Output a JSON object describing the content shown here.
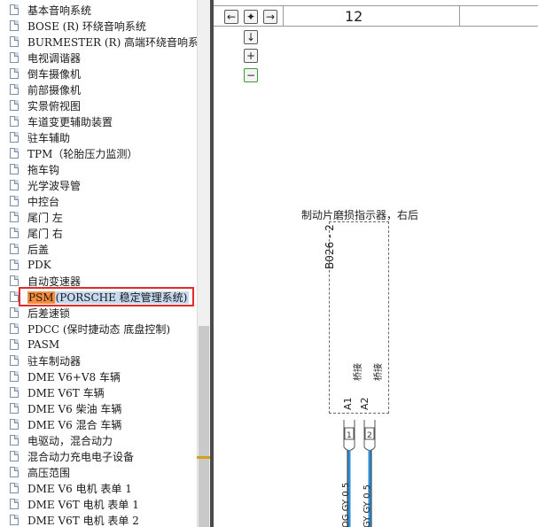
{
  "tree": {
    "items": [
      {
        "label": "基本音响系统"
      },
      {
        "label": "BOSE (R) 环绕音响系统"
      },
      {
        "label": "BURMESTER (R) 高端环绕音响系"
      },
      {
        "label": "电视调谐器"
      },
      {
        "label": "倒车摄像机"
      },
      {
        "label": "前部摄像机"
      },
      {
        "label": "实景俯视图"
      },
      {
        "label": "车道变更辅助装置"
      },
      {
        "label": "驻车辅助"
      },
      {
        "label": "TPM（轮胎压力监测）"
      },
      {
        "label": "拖车钩"
      },
      {
        "label": "光学波导管"
      },
      {
        "label": "中控台"
      },
      {
        "label": "尾门 左"
      },
      {
        "label": "尾门 右"
      },
      {
        "label": "后盖"
      },
      {
        "label": "PDK"
      },
      {
        "label": "自动变速器"
      },
      {
        "label": "PSM (PORSCHE 稳定管理系统)",
        "abbr": "PSM",
        "rest": "(PORSCHE 稳定管理系统)",
        "selected": true
      },
      {
        "label": "后差速锁"
      },
      {
        "label": "PDCC (保时捷动态 底盘控制)"
      },
      {
        "label": "PASM"
      },
      {
        "label": "驻车制动器"
      },
      {
        "label": "DME V6+V8 车辆"
      },
      {
        "label": "DME V6T 车辆"
      },
      {
        "label": "DME V6 柴油 车辆"
      },
      {
        "label": "DME V6 混合 车辆"
      },
      {
        "label": "电驱动，混合动力"
      },
      {
        "label": "混合动力充电电子设备"
      },
      {
        "label": "高压范围"
      },
      {
        "label": "DME V6 电机 表单 1"
      },
      {
        "label": "DME V6T 电机 表单 1"
      },
      {
        "label": "DME V6T 电机 表单 2"
      }
    ]
  },
  "diagram": {
    "grid_number": "12",
    "nav": {
      "left": "←",
      "center": "✦",
      "right": "→",
      "down": "↓",
      "zoom_in": "+",
      "zoom_out": "−"
    },
    "component_title": "制动片磨损指示器，右后",
    "component_id": "B026 - 2",
    "pins": [
      {
        "name": "桥接",
        "code": "A1",
        "wire": "OG GY 0.5"
      },
      {
        "name": "桥接",
        "code": "A2",
        "wire": "GY GY 0.5"
      }
    ],
    "wire_color": "#2d8fd6"
  },
  "colors": {
    "selection_border": "#e02b2b",
    "highlight_abbr": "#f58d3c",
    "highlight_rest": "#c8daf0"
  }
}
